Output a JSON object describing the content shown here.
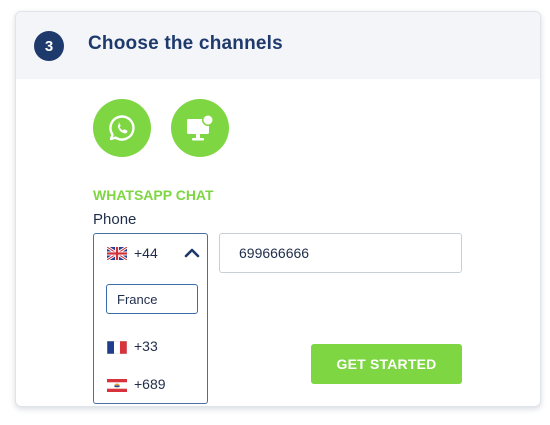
{
  "step": {
    "number": "3",
    "title": "Choose the channels"
  },
  "channels": [
    {
      "icon": "whatsapp-icon",
      "color": "#7ed642"
    },
    {
      "icon": "web-chat-icon",
      "color": "#7ed642"
    }
  ],
  "whatsapp": {
    "section_title": "WHATSAPP CHAT",
    "phone_label": "Phone",
    "selected_country": {
      "flag": "uk-flag-icon",
      "code": "+44"
    },
    "dropdown": {
      "search_value": "France",
      "options": [
        {
          "flag": "france-flag-icon",
          "code": "+33"
        },
        {
          "flag": "french-polynesia-flag-icon",
          "code": "+689"
        }
      ]
    },
    "phone_value": "699666666"
  },
  "cta": {
    "label": "GET STARTED"
  },
  "colors": {
    "accent": "#7ed642",
    "brand": "#1e3a6d"
  }
}
